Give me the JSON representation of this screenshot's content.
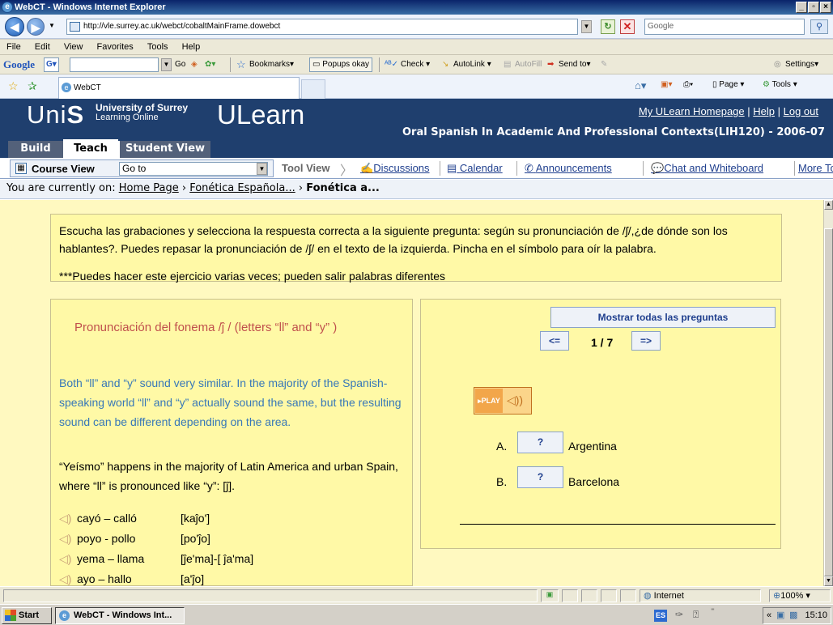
{
  "window": {
    "title": "WebCT - Windows Internet Explorer",
    "controls": [
      "_",
      "ô",
      "×"
    ]
  },
  "address": {
    "url": "http://vle.surrey.ac.uk/webct/cobaltMainFrame.dowebct",
    "search_placeholder": "Google"
  },
  "menu": [
    "File",
    "Edit",
    "View",
    "Favorites",
    "Tools",
    "Help"
  ],
  "google_toolbar": {
    "logo": "Google",
    "g_button": "G▾",
    "go": "Go",
    "bookmarks": "Bookmarks▾",
    "popups": "Popups okay",
    "check": "Check ▾",
    "autolink": "AutoLink ▾",
    "autofill": "AutoFill",
    "sendto": "Send to▾",
    "settings": "Settings▾"
  },
  "favorites": {
    "tab_label": "WebCT",
    "page": "Page ▾",
    "tools": "Tools ▾"
  },
  "ulearn": {
    "logo_uni": "Uni",
    "logo_s": "S",
    "uos_line1": "University of Surrey",
    "uos_line2": "Learning Online",
    "product": "ULearn",
    "links": {
      "home": "My ULearn Homepage",
      "sep1": " | ",
      "help": "Help",
      "sep2": " | ",
      "logout": "Log out"
    },
    "course_title": "Oral Spanish In Academic And Professional Contexts(LIH120) - 2006-07",
    "tabs": {
      "build": "Build",
      "teach": "Teach",
      "student": "Student View"
    },
    "course_view": "Course View",
    "goto": "Go to",
    "tool_view": "Tool View",
    "tools": [
      "Discussions",
      "Calendar",
      "Announcements",
      "Chat and Whiteboard",
      "More To"
    ],
    "breadcrumb": {
      "prefix": "You are currently on: ",
      "home": "Home Page",
      "sep": " › ",
      "level2": "Fonética Española...",
      "current": "Fonética a..."
    }
  },
  "instructions": {
    "line1": "Escucha las grabaciones y selecciona la respuesta correcta a la siguiente pregunta: según su pronunciación de /ʃ/,¿de dónde son los hablantes?. Puedes repasar la pronunciación de /ʃ/ en el texto de la izquierda. Pincha en el símbolo para oír la palabra.",
    "line2": "***Puedes hacer este ejercicio varias veces; pueden salir palabras diferentes"
  },
  "left": {
    "title": "Pronunciación del fonema /ĵ / (letters “ll” and “y” )",
    "p1": "Both “ll” and “y” sound very similar. In the majority of the Spanish-speaking world “ll” and “y” actually sound the same, but the resulting sound can be different depending on the area.",
    "p2": "“Yeísmo” happens in the majority of Latin America and urban Spain, where “ll” is pronounced like “y”: [ĵ].",
    "words": [
      {
        "word": "cayó – calló",
        "ipa": "[kaĵo']"
      },
      {
        "word": "poyo - pollo",
        "ipa": "[po'ĵo]"
      },
      {
        "word": "yema – llama",
        "ipa": "[ĵe'ma]-[ ĵa'ma]"
      },
      {
        "word": "ayo – hallo",
        "ipa": "[a'ĵo]"
      }
    ]
  },
  "quiz": {
    "show_all": "Mostrar todas las preguntas",
    "prev": "<=",
    "next": "=>",
    "counter": "1 / 7",
    "play": "▸PLAY",
    "options": [
      {
        "letter": "A.",
        "btn": "?",
        "answer": "Argentina"
      },
      {
        "letter": "B.",
        "btn": "?",
        "answer": "Barcelona"
      }
    ]
  },
  "status": {
    "zone": "Internet",
    "zoom": "100%"
  },
  "taskbar": {
    "start": "Start",
    "task": "WebCT - Windows Int...",
    "lang": "ES",
    "time": "15:10"
  }
}
